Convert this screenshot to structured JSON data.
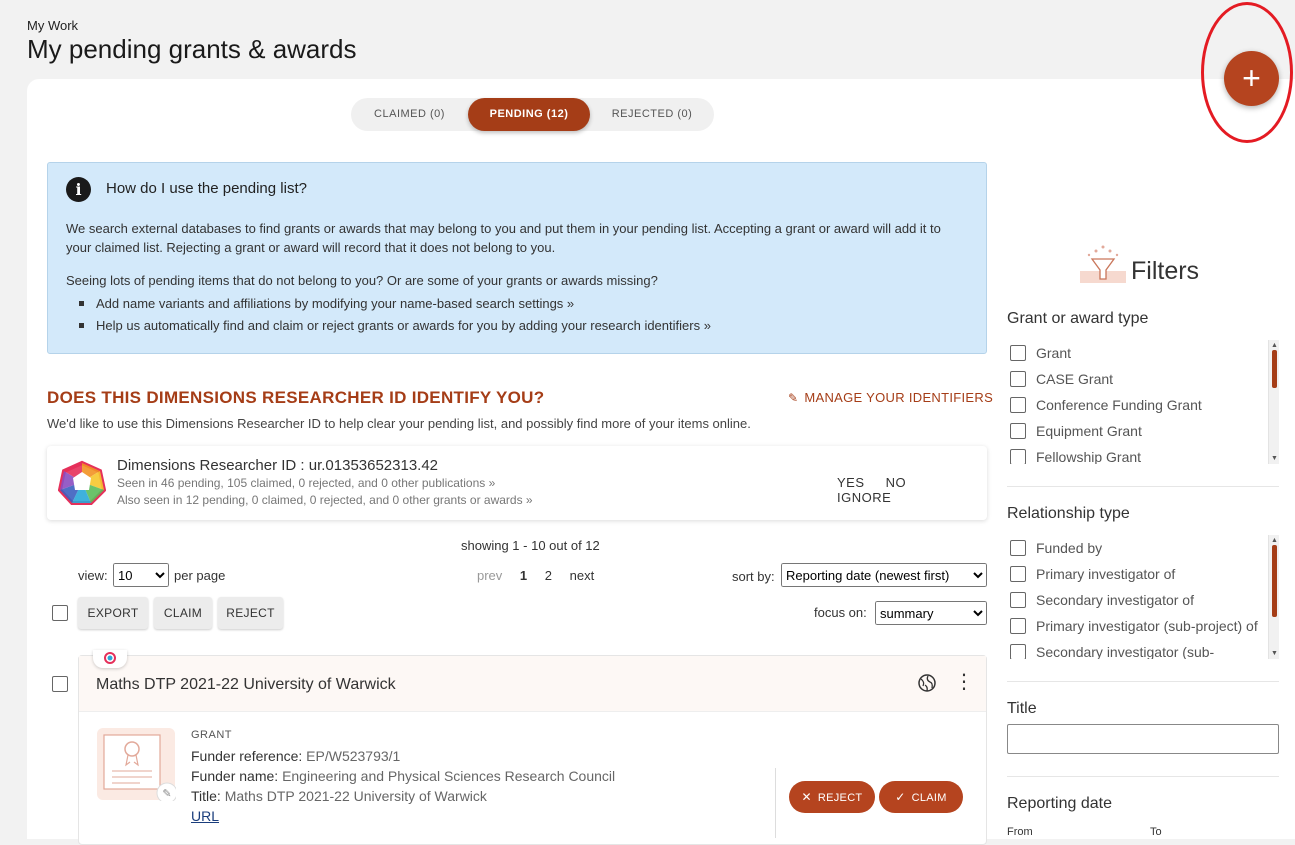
{
  "header": {
    "breadcrumb": "My Work",
    "title": "My pending grants & awards"
  },
  "fab": {
    "label": "+",
    "icon": "plus-icon"
  },
  "tabs": [
    {
      "label": "CLAIMED (0)",
      "active": false
    },
    {
      "label": "PENDING (12)",
      "active": true
    },
    {
      "label": "REJECTED (0)",
      "active": false
    }
  ],
  "info": {
    "title": "How do I use the pending list?",
    "paragraph1": "We search external databases to find grants or awards that may belong to you and put them in your pending list. Accepting a grant or award will add it to your claimed list. Rejecting a grant or award will record that it does not belong to you.",
    "paragraph2": "Seeing lots of pending items that do not belong to you? Or are some of your grants or awards missing?",
    "bullet1_prefix": "Add name variants and affiliations by modifying your ",
    "bullet1_link": "name-based search settings",
    "bullet1_suffix": " »",
    "bullet2_prefix": "Help us automatically find and claim or reject grants or awards for you by adding your ",
    "bullet2_link": "research identifiers",
    "bullet2_suffix": " »"
  },
  "identity": {
    "title": "DOES THIS DIMENSIONS RESEARCHER ID IDENTIFY YOU?",
    "manage_label": "MANAGE YOUR IDENTIFIERS",
    "subtitle": "We'd like to use this Dimensions Researcher ID to help clear your pending list, and possibly find more of your items online.",
    "id_label": "Dimensions Researcher ID : ",
    "id_value": "ur.01353652313.42",
    "seen_publications": "Seen in 46 pending, 105 claimed, 0 rejected, and 0 other publications »",
    "seen_grants": "Also seen in 12 pending, 0 claimed, 0 rejected, and 0 other grants or awards »",
    "yes": "YES",
    "no": "NO",
    "ignore": "IGNORE"
  },
  "list_controls": {
    "showing": "showing 1 - 10 out of 12",
    "view_label": "view:",
    "view_value": "10",
    "per_page": "per page",
    "prev": "prev",
    "page1": "1",
    "page2": "2",
    "next": "next",
    "sort_label": "sort by:",
    "sort_value": "Reporting date (newest first)",
    "export": "EXPORT",
    "claim": "CLAIM",
    "reject": "REJECT",
    "focus_label": "focus on:",
    "focus_value": "summary"
  },
  "item": {
    "title": "Maths DTP 2021-22 University of Warwick",
    "type": "GRANT",
    "funder_ref_label": "Funder reference: ",
    "funder_ref": "EP/W523793/1",
    "funder_name_label": "Funder name: ",
    "funder_name": "Engineering and Physical Sciences Research Council",
    "title_label": "Title: ",
    "title_value": "Maths DTP 2021-22 University of Warwick",
    "url": "URL",
    "reject": "REJECT",
    "claim": "CLAIM"
  },
  "filters": {
    "title": "Filters",
    "grant_type_title": "Grant or award type",
    "grant_types": [
      "Grant",
      "CASE Grant",
      "Conference Funding Grant",
      "Equipment Grant",
      "Fellowship Grant"
    ],
    "relationship_title": "Relationship type",
    "relationships": [
      "Funded by",
      "Primary investigator of",
      "Secondary investigator of",
      "Primary investigator (sub-project) of",
      "Secondary investigator (sub-"
    ],
    "title_field_label": "Title",
    "reporting_date_title": "Reporting date",
    "from_label": "From",
    "to_label": "To"
  },
  "colors": {
    "accent": "#a53d17",
    "fab": "#b5441f",
    "info_bg": "#d3e9fa",
    "annotation_ring": "#e41b23"
  }
}
